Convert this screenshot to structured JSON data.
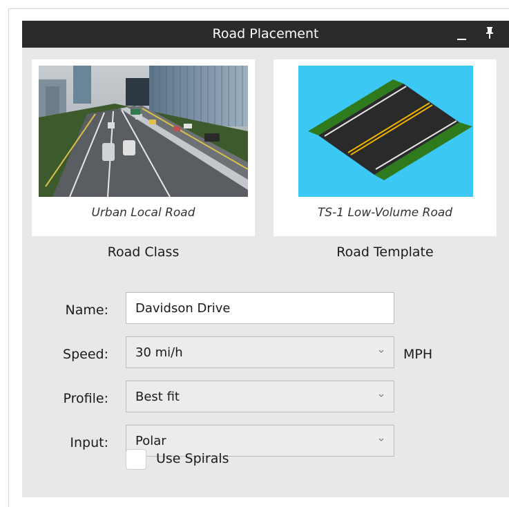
{
  "window": {
    "title": "Road Placement"
  },
  "road_class": {
    "caption": "Urban Local Road",
    "label": "Road Class"
  },
  "road_template": {
    "caption": "TS-1 Low-Volume Road",
    "label": "Road Template"
  },
  "form": {
    "name_label": "Name:",
    "name_value": "Davidson Drive",
    "speed_label": "Speed:",
    "speed_value": "30 mi/h",
    "speed_unit": "MPH",
    "profile_label": "Profile:",
    "profile_value": "Best fit",
    "input_label": "Input:",
    "input_value": "Polar",
    "spirals_label": "Use Spirals",
    "spirals_checked": false
  },
  "icons": {
    "minimize": "minimize-icon",
    "pin": "pin-icon",
    "dropdown": "chevron-down-icon"
  },
  "colors": {
    "titlebar": "#2b2b2b",
    "panel": "#e8e8e8",
    "template_sky": "#3cc8f5"
  }
}
